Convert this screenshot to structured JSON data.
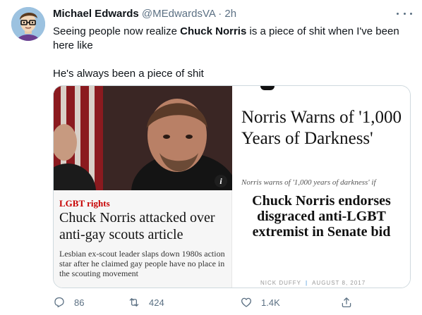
{
  "tweet": {
    "display_name": "Michael Edwards",
    "handle": "@MEdwardsVA",
    "separator": "·",
    "time": "2h",
    "text_line1_before": "Seeing people now realize ",
    "text_line1_bold": "Chuck Norris",
    "text_line1_after": " is a piece of shit when I've been here like",
    "text_line2": "He's always been a piece of shit"
  },
  "media": {
    "left_article": {
      "kicker": "LGBT rights",
      "headline": "Chuck Norris attacked over anti-gay scouts article",
      "standfirst": "Lesbian ex-scout leader slaps down 1980s action star after he claimed gay people have no place in the scouting movement",
      "info_badge": "i"
    },
    "right_article": {
      "headline": "Norris Warns of '1,000 Years of Darkness'",
      "dek": "Norris warns of '1,000 years of darkness' if",
      "overlay_text": "Chuck Norris endorses disgraced anti-LGBT extremist in Senate bid",
      "byline_author": "NICK DUFFY",
      "byline_separator": "|",
      "byline_date": "AUGUST 8, 2017"
    }
  },
  "actions": {
    "reply_count": "86",
    "retweet_count": "424",
    "like_count": "1.4K"
  },
  "icons": {
    "avatar": "cartoon-avatar",
    "more": "more-dots-icon",
    "reply": "reply-icon",
    "retweet": "retweet-icon",
    "like": "heart-icon",
    "share": "share-icon"
  },
  "colors": {
    "text_primary": "#0f1419",
    "text_secondary": "#5b7083",
    "guardian_red": "#c70000"
  }
}
